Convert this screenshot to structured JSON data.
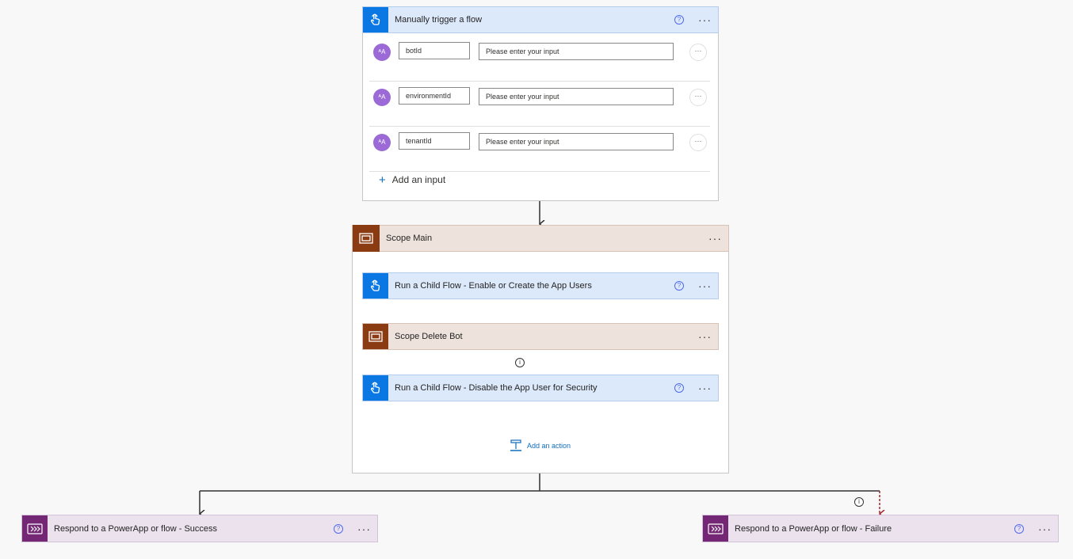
{
  "trigger": {
    "title": "Manually trigger a flow",
    "icon": "touch-hand-icon",
    "help_glyph": "?",
    "more_glyph": "···",
    "inputs": [
      {
        "avatar": "ᴬA",
        "name": "botId",
        "placeholder": "Please enter your input",
        "more": "···"
      },
      {
        "avatar": "ᴬA",
        "name": "environmentId",
        "placeholder": "Please enter your input",
        "more": "···"
      },
      {
        "avatar": "ᴬA",
        "name": "tenantId",
        "placeholder": "Please enter your input",
        "more": "···"
      }
    ],
    "add_input_plus": "+",
    "add_input_label": "Add an input"
  },
  "scope_main": {
    "title": "Scope Main",
    "more_glyph": "···",
    "steps": [
      {
        "title": "Run a Child Flow - Enable or Create the App Users",
        "type": "child-flow"
      },
      {
        "title": "Scope Delete Bot",
        "type": "scope"
      },
      {
        "title": "Run a Child Flow - Disable the App User for Security",
        "type": "child-flow"
      }
    ],
    "add_action_label": "Add an action"
  },
  "responses": [
    {
      "title": "Respond to a PowerApp or flow - Success"
    },
    {
      "title": "Respond to a PowerApp or flow - Failure"
    }
  ],
  "info_glyph": "i",
  "colors": {
    "trigger_blue": "#0b77e3",
    "scope_brown": "#8a3b12",
    "respond_purple": "#742774",
    "failure_arrow": "#a4262c",
    "link_blue": "#0f6cbd"
  }
}
